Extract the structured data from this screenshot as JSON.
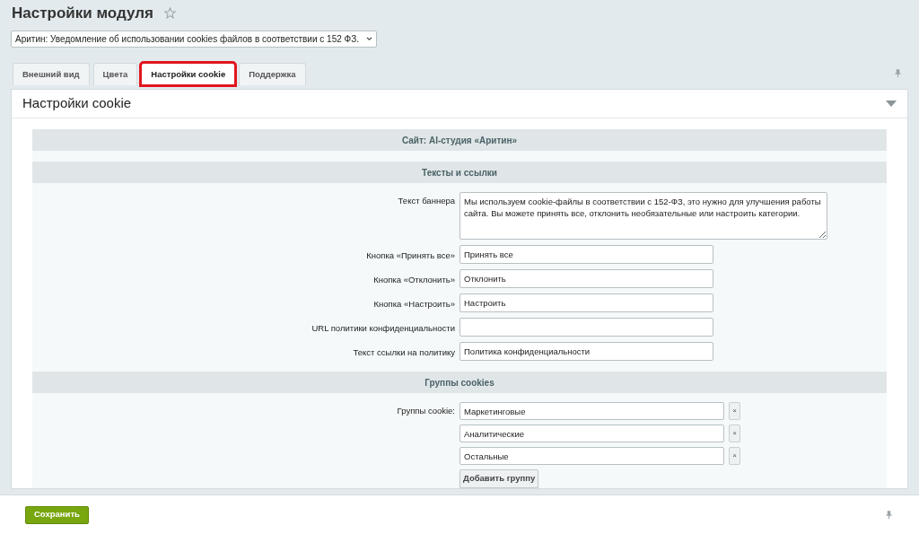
{
  "page_title": "Настройки модуля",
  "module_select": {
    "value": "Аритин: Уведомление об использовании cookies файлов в соответствии с 152 ФЗ."
  },
  "tabs": [
    {
      "label": "Внешний вид",
      "selected": false,
      "highlighted": false
    },
    {
      "label": "Цвета",
      "selected": false,
      "highlighted": false
    },
    {
      "label": "Настройки cookie",
      "selected": true,
      "highlighted": true
    },
    {
      "label": "Поддержка",
      "selected": false,
      "highlighted": false
    }
  ],
  "panel": {
    "title": "Настройки cookie",
    "expanded": true,
    "site_heading": "Сайт: AI-студия «Аритин»",
    "sections": [
      {
        "heading": "Тексты и ссылки",
        "fields": [
          {
            "kind": "textarea",
            "label": "Текст баннера",
            "value": "Мы используем cookie-файлы в соответствии с 152-ФЗ, это нужно для улучшения работы сайта. Вы можете принять все, отклонить необязательные или настроить категории."
          },
          {
            "kind": "input",
            "label": "Кнопка «Принять все»",
            "value": "Принять все"
          },
          {
            "kind": "input",
            "label": "Кнопка «Отклонить»",
            "value": "Отклонить"
          },
          {
            "kind": "input",
            "label": "Кнопка «Настроить»",
            "value": "Настроить"
          },
          {
            "kind": "input",
            "label": "URL политики конфиденциальности"
          },
          {
            "kind": "input",
            "label": "Текст ссылки на политику",
            "value": "Политика конфиденциальности"
          }
        ]
      },
      {
        "heading": "Группы cookies",
        "fields": [
          {
            "kind": "groups",
            "label": "Группы cookie:",
            "groups": [
              {
                "value": "Маркетинговые",
                "remove": "×"
              },
              {
                "value": "Аналитические",
                "remove": "×"
              },
              {
                "value": "Остальные",
                "remove": "×"
              }
            ],
            "add_button": "Добавить группу"
          }
        ]
      }
    ]
  },
  "footer": {
    "save_button": "Сохранить"
  }
}
